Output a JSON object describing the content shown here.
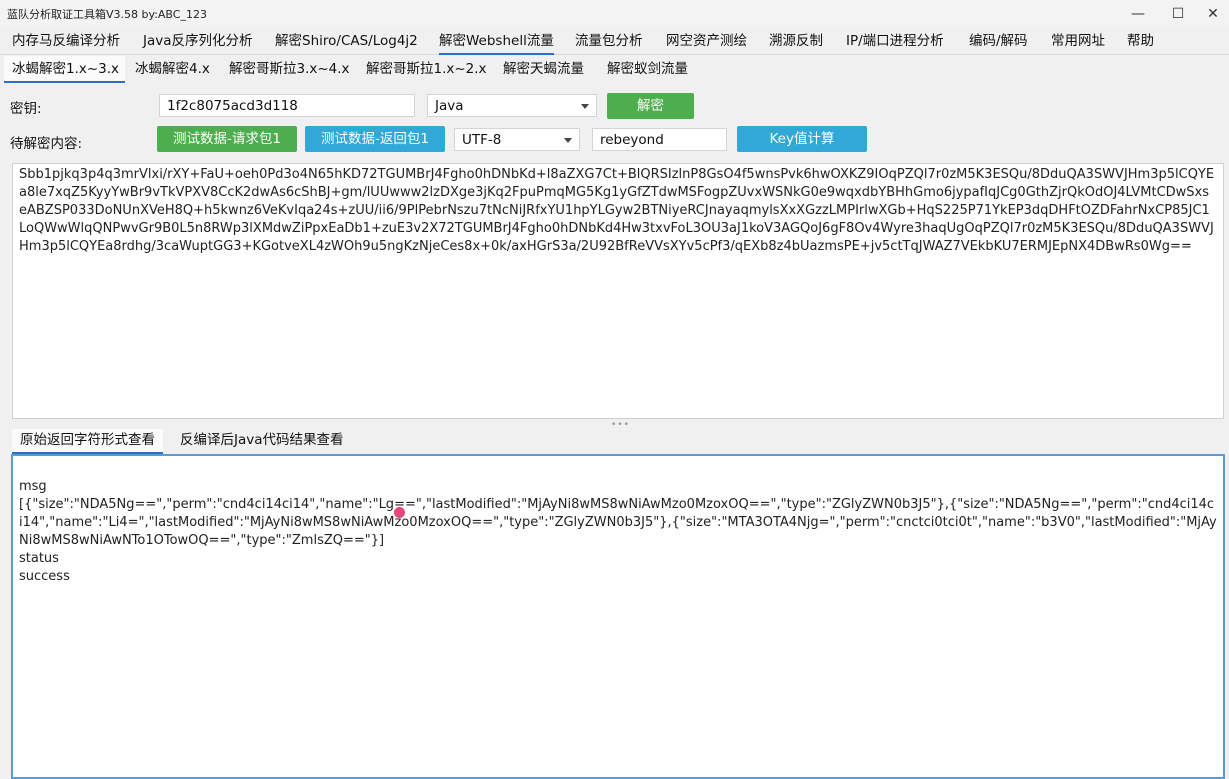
{
  "window": {
    "title": "蓝队分析取证工具箱V3.58 by:ABC_123",
    "minimize_glyph": "—",
    "maximize_glyph": "☐",
    "close_glyph": "✕"
  },
  "menu": {
    "items": [
      {
        "label": "内存马反编译分析"
      },
      {
        "label": "Java反序列化分析"
      },
      {
        "label": "解密Shiro/CAS/Log4j2"
      },
      {
        "label": "解密Webshell流量"
      },
      {
        "label": "流量包分析"
      },
      {
        "label": "网空资产测绘"
      },
      {
        "label": "溯源反制"
      },
      {
        "label": "IP/端口进程分析"
      },
      {
        "label": "编码/解码"
      },
      {
        "label": "常用网址"
      },
      {
        "label": "帮助"
      }
    ],
    "active": "解密Webshell流量"
  },
  "subtabs": {
    "items": [
      {
        "label": "冰蝎解密1.x~3.x"
      },
      {
        "label": "冰蝎解密4.x"
      },
      {
        "label": "解密哥斯拉3.x~4.x"
      },
      {
        "label": "解密哥斯拉1.x~2.x"
      },
      {
        "label": "解密天蝎流量"
      },
      {
        "label": "解密蚁剑流量"
      }
    ],
    "active": "冰蝎解密1.x~3.x"
  },
  "form": {
    "key_label": "密钥:",
    "key_value": "1f2c8075acd3d118",
    "language_value": "Java",
    "decrypt_button": "解密",
    "content_label": "待解密内容:",
    "test_request_button": "测试数据-请求包1",
    "test_response_button": "测试数据-返回包1",
    "encoding_value": "UTF-8",
    "password_value": "rebeyond",
    "key_calc_button": "Key值计算"
  },
  "colors": {
    "green_button": "#4cae4c",
    "cyan_button": "#31a8d6",
    "accent_blue": "#2f6ec7",
    "result_border": "#5b9bd5"
  },
  "input_content": "Sbb1pjkq3p4q3mrVlxi/rXY+FaU+oeh0Pd3o4N65hKD72TGUMBrJ4Fgho0hDNbKd+l8aZXG7Ct+BlQRSIzlnP8GsO4f5wnsPvk6hwOXKZ9IOqPZQl7r0zM5K3ESQu/8DduQA3SWVJHm3p5lCQYEa8le7xqZ5KyyYwBr9vTkVPXV8CcK2dwAs6cShBJ+gm/lUUwww2lzDXge3jKq2FpuPmqMG5Kg1yGfZTdwMSFogpZUvxWSNkG0e9wqxdbYBHhGmo6jypafIqJCg0GthZjrQkOdOJ4LVMtCDwSxseABZSP033DoNUnXVeH8Q+h5kwnz6VeKvIqa24s+zUU/ii6/9PlPebrNszu7tNcNiJRfxYU1hpYLGyw2BTNiyeRCJnayaqmylsXxXGzzLMPIrlwXGb+HqS225P71YkEP3dqDHFtOZDFahrNxCP85JC1LoQWwWlqQNPwvGr9B0L5n8RWp3lXMdwZiPpxEaDb1+zuE3v2X72TGUMBrJ4Fgho0hDNbKd4Hw3txvFoL3OU3aJ1koV3AGQoJ6gF8Ov4Wyre3haqUgOqPZQl7r0zM5K3ESQu/8DduQA3SWVJHm3p5lCQYEa8rdhg/3caWuptGG3+KGotveXL4zWOh9u5ngKzNjeCes8x+0k/axHGrS3a/2U92BfReVVsXYv5cPf3/qEXb8z4bUazmsPE+jv5ctTqJWAZ7VEkbKU7ERMJEpNX4DBwRs0Wg==",
  "result_tabs": {
    "items": [
      {
        "label": "原始返回字符形式查看"
      },
      {
        "label": "反编译后Java代码结果查看"
      }
    ],
    "active": "原始返回字符形式查看"
  },
  "result": {
    "line1": "msg",
    "line2": "[{\"size\":\"NDA5Ng==\",\"perm\":\"cnd4ci14ci14\",\"name\":\"Lg==\",\"lastModified\":\"MjAyNi8wMS8wNiAwMzo0MzoxOQ==\",\"type\":\"ZGlyZWN0b3J5\"},{\"size\":\"NDA5Ng==\",\"perm\":\"cnd4ci14ci14\",\"name\":\"Li4=\",\"lastModified\":\"MjAyNi8wMS8wNiAwMzo0MzoxOQ==\",\"type\":\"ZGlyZWN0b3J5\"},{\"size\":\"MTA3OTA4Njg=\",\"perm\":\"cnctci0tci0t\",\"name\":\"b3V0\",\"lastModified\":\"MjAyNi8wMS8wNiAwNTo1OTowOQ==\",\"type\":\"ZmlsZQ==\"}]",
    "line3": "status",
    "line4": "success"
  }
}
